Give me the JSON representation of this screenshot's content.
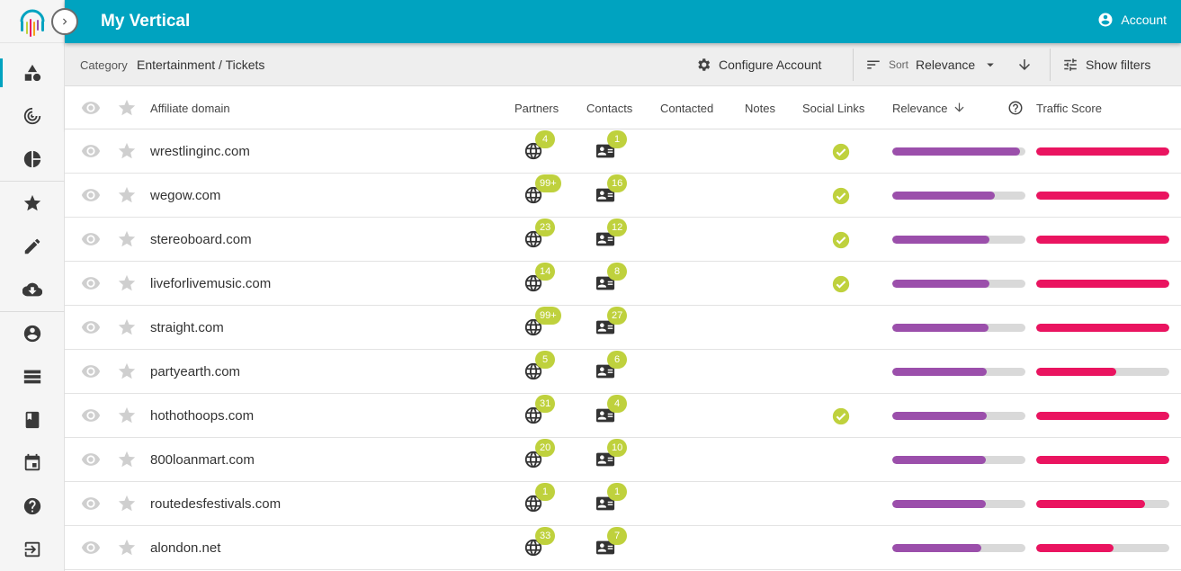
{
  "app": {
    "title": "My Vertical",
    "account_label": "Account"
  },
  "sidebar": {
    "items": [
      {
        "name": "shapes-icon"
      },
      {
        "name": "radar-icon"
      },
      {
        "name": "pie-chart-icon"
      },
      {
        "name": "star-icon"
      },
      {
        "name": "pencil-icon"
      },
      {
        "name": "cloud-download-icon"
      },
      {
        "name": "account-circle-icon"
      },
      {
        "name": "list-icon"
      },
      {
        "name": "book-icon"
      },
      {
        "name": "calendar-icon"
      },
      {
        "name": "help-icon"
      },
      {
        "name": "logout-icon"
      }
    ]
  },
  "toolbar": {
    "category_label": "Category",
    "category_value": "Entertainment / Tickets",
    "configure_label": "Configure Account",
    "sort_label": "Sort",
    "sort_value": "Relevance",
    "filters_label": "Show filters"
  },
  "table": {
    "headers": {
      "domain": "Affiliate domain",
      "partners": "Partners",
      "contacts": "Contacts",
      "contacted": "Contacted",
      "notes": "Notes",
      "social": "Social Links",
      "relevance": "Relevance",
      "traffic": "Traffic Score"
    },
    "rows": [
      {
        "domain": "wrestlinginc.com",
        "partners": "4",
        "contacts": "1",
        "social": true,
        "relevance": 0.96,
        "traffic": 1.0
      },
      {
        "domain": "wegow.com",
        "partners": "99+",
        "contacts": "16",
        "social": true,
        "relevance": 0.77,
        "traffic": 1.0
      },
      {
        "domain": "stereoboard.com",
        "partners": "23",
        "contacts": "12",
        "social": true,
        "relevance": 0.73,
        "traffic": 1.0
      },
      {
        "domain": "liveforlivemusic.com",
        "partners": "14",
        "contacts": "8",
        "social": true,
        "relevance": 0.73,
        "traffic": 1.0
      },
      {
        "domain": "straight.com",
        "partners": "99+",
        "contacts": "27",
        "social": false,
        "relevance": 0.72,
        "traffic": 1.0
      },
      {
        "domain": "partyearth.com",
        "partners": "5",
        "contacts": "6",
        "social": false,
        "relevance": 0.71,
        "traffic": 0.6
      },
      {
        "domain": "hothothoops.com",
        "partners": "31",
        "contacts": "4",
        "social": true,
        "relevance": 0.71,
        "traffic": 1.0
      },
      {
        "domain": "800loanmart.com",
        "partners": "20",
        "contacts": "10",
        "social": false,
        "relevance": 0.7,
        "traffic": 1.0
      },
      {
        "domain": "routedesfestivals.com",
        "partners": "1",
        "contacts": "1",
        "social": false,
        "relevance": 0.7,
        "traffic": 0.82
      },
      {
        "domain": "alondon.net",
        "partners": "33",
        "contacts": "7",
        "social": false,
        "relevance": 0.67,
        "traffic": 0.58
      }
    ]
  },
  "colors": {
    "brand": "#00a3c0",
    "badge": "#bfd13d",
    "relevance": "#9b4fab",
    "traffic": "#ea1460",
    "check": "#bfd13d"
  }
}
